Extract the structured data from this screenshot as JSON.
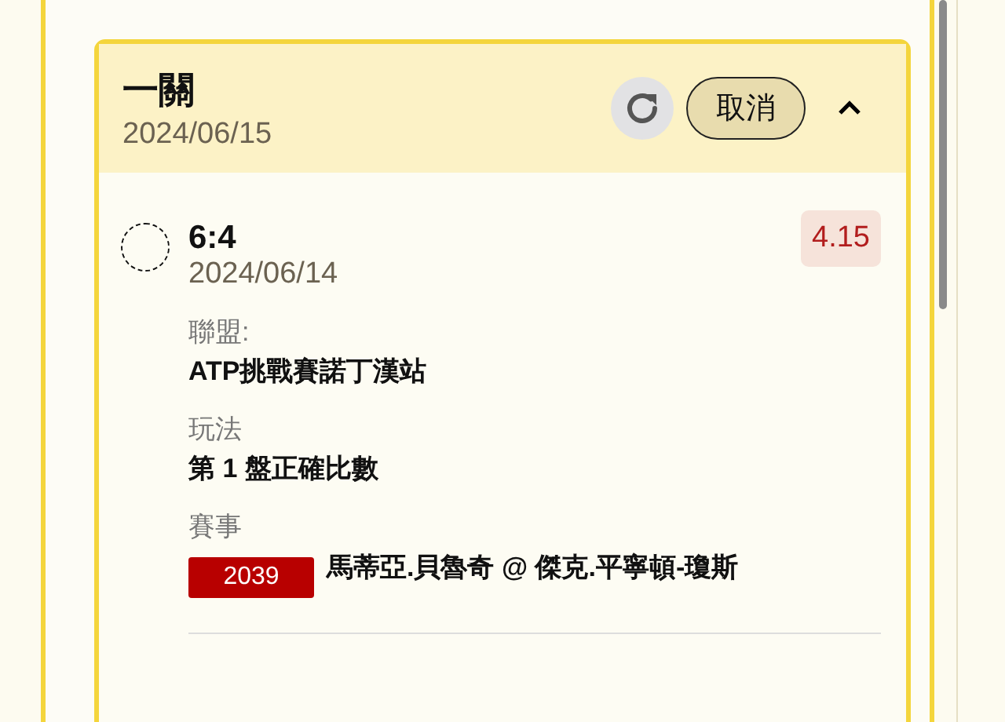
{
  "parlay": {
    "title": "一關",
    "date": "2024/06/15",
    "cancel_label": "取消",
    "expanded": true,
    "bets": [
      {
        "selected": false,
        "pick": "6:4",
        "date": "2024/06/14",
        "odds": "4.15",
        "fields": [
          {
            "label": "聯盟:",
            "value": "ATP挑戰賽諾丁漢站"
          },
          {
            "label": "玩法",
            "value": "第 1 盤正確比數"
          },
          {
            "label": "賽事",
            "code": "2039",
            "value": "馬蒂亞.貝魯奇 @ 傑克.平寧頓-瓊斯"
          }
        ]
      }
    ]
  }
}
